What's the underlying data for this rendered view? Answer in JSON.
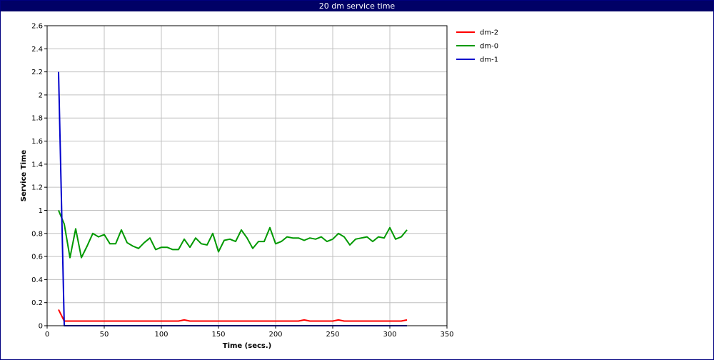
{
  "window": {
    "title": "20 dm service time"
  },
  "chart_data": {
    "type": "line",
    "title": "20 dm service time",
    "xlabel": "Time (secs.)",
    "ylabel": "Service Time",
    "xlim": [
      0,
      350
    ],
    "ylim": [
      0,
      2.6
    ],
    "xticks": [
      0,
      50,
      100,
      150,
      200,
      250,
      300,
      350
    ],
    "yticks": [
      0,
      0.2,
      0.4,
      0.6,
      0.8,
      1,
      1.2,
      1.4,
      1.6,
      1.8,
      2,
      2.2,
      2.4,
      2.6
    ],
    "grid": true,
    "legend_position": "right",
    "series": [
      {
        "name": "dm-2",
        "color": "#ff0000",
        "points": [
          [
            10,
            0.14
          ],
          [
            15,
            0.04
          ],
          [
            20,
            0.04
          ],
          [
            25,
            0.04
          ],
          [
            30,
            0.04
          ],
          [
            35,
            0.04
          ],
          [
            40,
            0.04
          ],
          [
            45,
            0.04
          ],
          [
            50,
            0.04
          ],
          [
            55,
            0.04
          ],
          [
            60,
            0.04
          ],
          [
            65,
            0.04
          ],
          [
            70,
            0.04
          ],
          [
            75,
            0.04
          ],
          [
            80,
            0.04
          ],
          [
            85,
            0.04
          ],
          [
            90,
            0.04
          ],
          [
            95,
            0.04
          ],
          [
            100,
            0.04
          ],
          [
            105,
            0.04
          ],
          [
            110,
            0.04
          ],
          [
            115,
            0.04
          ],
          [
            120,
            0.05
          ],
          [
            125,
            0.04
          ],
          [
            130,
            0.04
          ],
          [
            135,
            0.04
          ],
          [
            140,
            0.04
          ],
          [
            145,
            0.04
          ],
          [
            150,
            0.04
          ],
          [
            155,
            0.04
          ],
          [
            160,
            0.04
          ],
          [
            165,
            0.04
          ],
          [
            170,
            0.04
          ],
          [
            175,
            0.04
          ],
          [
            180,
            0.04
          ],
          [
            185,
            0.04
          ],
          [
            190,
            0.04
          ],
          [
            195,
            0.04
          ],
          [
            200,
            0.04
          ],
          [
            205,
            0.04
          ],
          [
            210,
            0.04
          ],
          [
            215,
            0.04
          ],
          [
            220,
            0.04
          ],
          [
            225,
            0.05
          ],
          [
            230,
            0.04
          ],
          [
            235,
            0.04
          ],
          [
            240,
            0.04
          ],
          [
            245,
            0.04
          ],
          [
            250,
            0.04
          ],
          [
            255,
            0.05
          ],
          [
            260,
            0.04
          ],
          [
            265,
            0.04
          ],
          [
            270,
            0.04
          ],
          [
            275,
            0.04
          ],
          [
            280,
            0.04
          ],
          [
            285,
            0.04
          ],
          [
            290,
            0.04
          ],
          [
            295,
            0.04
          ],
          [
            300,
            0.04
          ],
          [
            305,
            0.04
          ],
          [
            310,
            0.04
          ],
          [
            315,
            0.05
          ]
        ]
      },
      {
        "name": "dm-0",
        "color": "#009900",
        "points": [
          [
            10,
            1.0
          ],
          [
            15,
            0.88
          ],
          [
            20,
            0.59
          ],
          [
            25,
            0.84
          ],
          [
            30,
            0.59
          ],
          [
            35,
            0.69
          ],
          [
            40,
            0.8
          ],
          [
            45,
            0.77
          ],
          [
            50,
            0.79
          ],
          [
            55,
            0.71
          ],
          [
            60,
            0.71
          ],
          [
            65,
            0.83
          ],
          [
            70,
            0.72
          ],
          [
            75,
            0.69
          ],
          [
            80,
            0.67
          ],
          [
            85,
            0.72
          ],
          [
            90,
            0.76
          ],
          [
            95,
            0.66
          ],
          [
            100,
            0.68
          ],
          [
            105,
            0.68
          ],
          [
            110,
            0.66
          ],
          [
            115,
            0.66
          ],
          [
            120,
            0.75
          ],
          [
            125,
            0.68
          ],
          [
            130,
            0.76
          ],
          [
            135,
            0.71
          ],
          [
            140,
            0.7
          ],
          [
            145,
            0.8
          ],
          [
            150,
            0.64
          ],
          [
            155,
            0.74
          ],
          [
            160,
            0.75
          ],
          [
            165,
            0.73
          ],
          [
            170,
            0.83
          ],
          [
            175,
            0.76
          ],
          [
            180,
            0.67
          ],
          [
            185,
            0.73
          ],
          [
            190,
            0.73
          ],
          [
            195,
            0.85
          ],
          [
            200,
            0.71
          ],
          [
            205,
            0.73
          ],
          [
            210,
            0.77
          ],
          [
            215,
            0.76
          ],
          [
            220,
            0.76
          ],
          [
            225,
            0.74
          ],
          [
            230,
            0.76
          ],
          [
            235,
            0.75
          ],
          [
            240,
            0.77
          ],
          [
            245,
            0.73
          ],
          [
            250,
            0.75
          ],
          [
            255,
            0.8
          ],
          [
            260,
            0.77
          ],
          [
            265,
            0.7
          ],
          [
            270,
            0.75
          ],
          [
            275,
            0.76
          ],
          [
            280,
            0.77
          ],
          [
            285,
            0.73
          ],
          [
            290,
            0.77
          ],
          [
            295,
            0.76
          ],
          [
            300,
            0.85
          ],
          [
            305,
            0.75
          ],
          [
            310,
            0.77
          ],
          [
            315,
            0.83
          ]
        ]
      },
      {
        "name": "dm-1",
        "color": "#0000cc",
        "points": [
          [
            10,
            2.2
          ],
          [
            15,
            0.0
          ],
          [
            20,
            0.0
          ],
          [
            50,
            0.0
          ],
          [
            100,
            0.0
          ],
          [
            150,
            0.0
          ],
          [
            200,
            0.0
          ],
          [
            250,
            0.0
          ],
          [
            300,
            0.0
          ],
          [
            315,
            0.0
          ]
        ]
      }
    ]
  }
}
